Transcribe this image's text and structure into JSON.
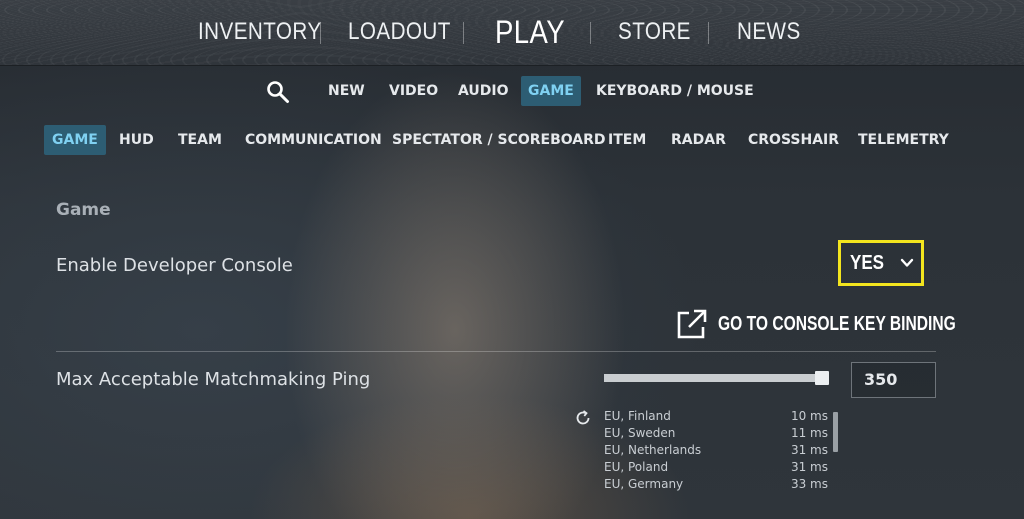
{
  "topnav": {
    "items": [
      "INVENTORY",
      "LOADOUT",
      "PLAY",
      "STORE",
      "NEWS"
    ]
  },
  "subtabs": {
    "items": [
      "NEW",
      "VIDEO",
      "AUDIO",
      "GAME",
      "KEYBOARD / MOUSE"
    ],
    "active": "GAME"
  },
  "cattabs": {
    "items": [
      "GAME",
      "HUD",
      "TEAM",
      "COMMUNICATION",
      "SPECTATOR / SCOREBOARD",
      "ITEM",
      "RADAR",
      "CROSSHAIR",
      "TELEMETRY"
    ],
    "active": "GAME"
  },
  "section": {
    "title": "Game",
    "developer_console": {
      "label": "Enable Developer Console",
      "value": "YES"
    },
    "console_link": "GO TO CONSOLE KEY BINDING",
    "ping": {
      "label": "Max Acceptable Matchmaking Ping",
      "value": "350",
      "slider_fraction": 0.97
    },
    "servers": [
      {
        "name": "EU, Finland",
        "ms": "10 ms"
      },
      {
        "name": "EU, Sweden",
        "ms": "11 ms"
      },
      {
        "name": "EU, Netherlands",
        "ms": "31 ms"
      },
      {
        "name": "EU, Poland",
        "ms": "31 ms"
      },
      {
        "name": "EU, Germany",
        "ms": "33 ms"
      }
    ]
  },
  "colors": {
    "accent_highlight": "#f3e51e",
    "active_tab_bg": "#2d5d73",
    "active_tab_text": "#7fd1f2"
  }
}
